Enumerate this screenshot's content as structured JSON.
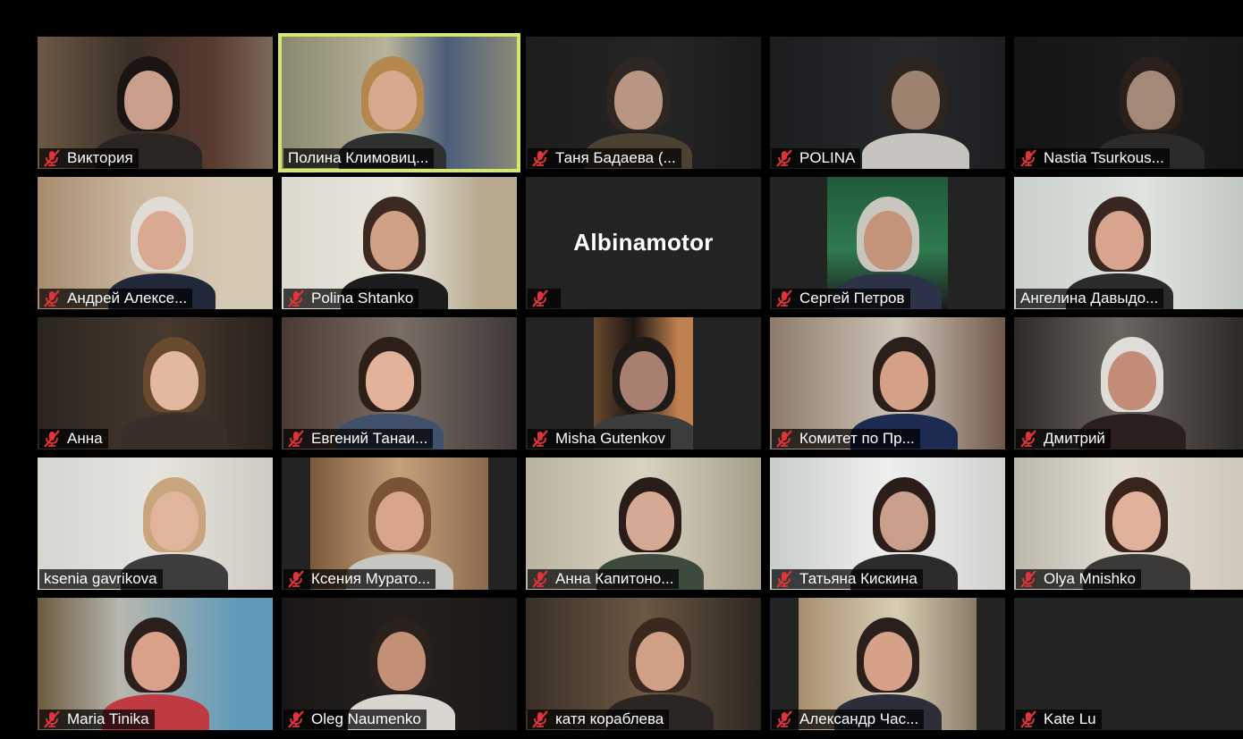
{
  "meeting": {
    "view": "Gallery View",
    "active_speaker": "Полина Климовиц..."
  },
  "colors": {
    "active_border": "#d5e86a",
    "muted_icon": "#e0333a",
    "tile_background": "#232323"
  },
  "participants": [
    {
      "name": "Виктория",
      "muted": true
    },
    {
      "name": "Полина Климовиц...",
      "muted": false,
      "active": true
    },
    {
      "name": "Таня Бадаева (...",
      "muted": true
    },
    {
      "name": "POLINA",
      "muted": true
    },
    {
      "name": "Nastia Tsurkous...",
      "muted": true
    },
    {
      "name": "Андрей Алексе...",
      "muted": true
    },
    {
      "name": "Polina Shtanko",
      "muted": true
    },
    {
      "name": "Albinamotor",
      "muted": true,
      "video_off": true
    },
    {
      "name": "Сергей Петров",
      "muted": true
    },
    {
      "name": "Ангелина Давыдо...",
      "muted": false
    },
    {
      "name": "Анна",
      "muted": true
    },
    {
      "name": "Евгений Танаи...",
      "muted": true
    },
    {
      "name": "Misha Gutenkov",
      "muted": true
    },
    {
      "name": "Комитет по Пр...",
      "muted": true
    },
    {
      "name": "Дмитрий",
      "muted": true
    },
    {
      "name": "ksenia gavrikova",
      "muted": false
    },
    {
      "name": "Ксения Murато...",
      "muted": true
    },
    {
      "name": "Анна Капитоно...",
      "muted": true
    },
    {
      "name": "Татьяна Кискина",
      "muted": true
    },
    {
      "name": "Olya Mnishko",
      "muted": true
    },
    {
      "name": "Maria Tinika",
      "muted": true
    },
    {
      "name": "Oleg Naumenko",
      "muted": true
    },
    {
      "name": "катя кораблева",
      "muted": true
    },
    {
      "name": "Александр Час...",
      "muted": true
    },
    {
      "name": "Kate Lu",
      "muted": true,
      "video_off": true
    }
  ]
}
